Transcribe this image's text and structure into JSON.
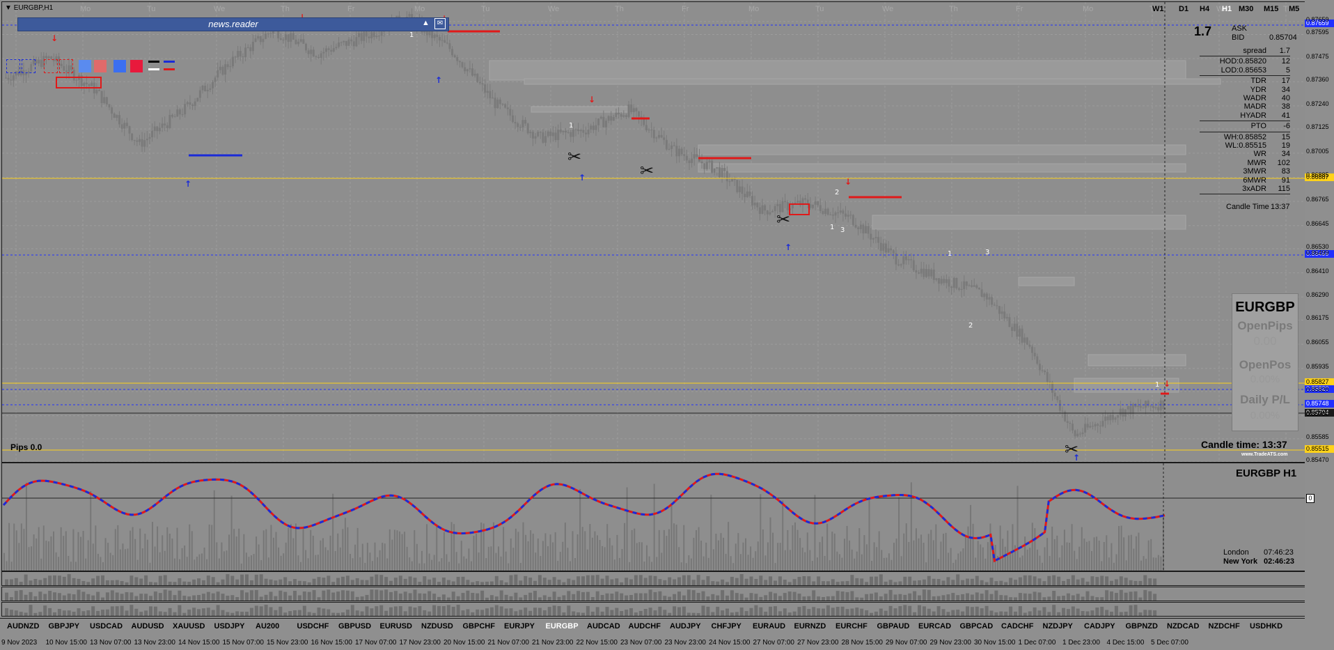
{
  "window": {
    "title": "EURGBP,H1"
  },
  "news_reader": {
    "label": "news.reader"
  },
  "timeframes": [
    "W1",
    "D1",
    "H4",
    "H1",
    "M30",
    "M15",
    "M5"
  ],
  "active_timeframe": "H1",
  "day_labels": [
    "Mo",
    "Tu",
    "We",
    "Th",
    "Fr",
    "Mo",
    "Tu",
    "We",
    "Th",
    "Fr",
    "Mo",
    "Tu",
    "We",
    "Th",
    "Fr",
    "Mo",
    "Tu",
    "We",
    "Th",
    "Fr",
    "Mo"
  ],
  "price_axis": [
    "0.87659",
    "0.87595",
    "0.87475",
    "0.87360",
    "0.87240",
    "0.87125",
    "0.87005",
    "0.86885",
    "0.86765",
    "0.86645",
    "0.86530",
    "0.86499",
    "0.86410",
    "0.86290",
    "0.86175",
    "0.86055",
    "0.85935",
    "0.85820",
    "0.85700",
    "0.85585",
    "0.85470"
  ],
  "price_tags": {
    "top_blue": "0.87659",
    "yellow_high": "0.86887",
    "blue_mid": "0.86499",
    "yellow_low": "0.85827",
    "blue_low1": "0.85820",
    "blue_low2": "0.85748",
    "bid": "0.85704",
    "yellow_bottom": "0.85515"
  },
  "stats": {
    "spread_big": "1.7",
    "ask_label": "ASK",
    "bid_label": "BID",
    "bid_value": "0.85704",
    "rows": [
      {
        "k": "spread",
        "v": "1.7"
      },
      {
        "k": "HOD:0.85820",
        "v": "12"
      },
      {
        "k": "LOD:0.85653",
        "v": "5"
      },
      {
        "k": "TDR",
        "v": "17"
      },
      {
        "k": "YDR",
        "v": "34"
      },
      {
        "k": "WADR",
        "v": "40"
      },
      {
        "k": "MADR",
        "v": "38"
      },
      {
        "k": "HYADR",
        "v": "41"
      },
      {
        "k": "PTO",
        "v": "-6"
      },
      {
        "k": "WH:0.85852",
        "v": "15"
      },
      {
        "k": "WL:0.85515",
        "v": "19"
      },
      {
        "k": "WR",
        "v": "34"
      },
      {
        "k": "MWR",
        "v": "102"
      },
      {
        "k": "3MWR",
        "v": "83"
      },
      {
        "k": "6MWR",
        "v": "91"
      },
      {
        "k": "3xADR",
        "v": "115"
      }
    ],
    "candle_time_label": "Candle Time",
    "candle_time_value": "13:37"
  },
  "panel": {
    "symbol": "EURGBP",
    "open_pips_label": "OpenPips",
    "open_pips_value": "0.00",
    "open_pos_label": "OpenPos",
    "open_pos_value": "0.00%",
    "daily_pl_label": "Daily P/L",
    "daily_pl_value": "0.00%"
  },
  "candle_time_big": {
    "label": "Candle time:",
    "value": "13:37"
  },
  "brand": "www.TradeATS.com",
  "pips_label": "Pips 0.0",
  "osc": {
    "title": "EURGBP  H1",
    "zero_label": "0",
    "london_label": "London",
    "london_time": "07:46:23",
    "newyork_label": "New York",
    "newyork_time": "02:46:23"
  },
  "symbols": [
    "AUDNZD",
    "GBPJPY",
    "USDCAD",
    "AUDUSD",
    "XAUUSD",
    "USDJPY",
    "AU200",
    "USDCHF",
    "GBPUSD",
    "EURUSD",
    "NZDUSD",
    "GBPCHF",
    "EURJPY",
    "EURGBP",
    "AUDCAD",
    "AUDCHF",
    "AUDJPY",
    "CHFJPY",
    "EURAUD",
    "EURNZD",
    "EURCHF",
    "GBPAUD",
    "EURCAD",
    "GBPCAD",
    "CADCHF",
    "NZDJPY",
    "CADJPY",
    "GBPNZD",
    "NZDCAD",
    "NZDCHF",
    "USDHKD"
  ],
  "active_symbol": "EURGBP",
  "time_axis": [
    "9 Nov 2023",
    "10 Nov 15:00",
    "13 Nov 07:00",
    "13 Nov 23:00",
    "14 Nov 15:00",
    "15 Nov 07:00",
    "15 Nov 23:00",
    "16 Nov 15:00",
    "17 Nov 07:00",
    "17 Nov 23:00",
    "20 Nov 15:00",
    "21 Nov 07:00",
    "21 Nov 23:00",
    "22 Nov 15:00",
    "23 Nov 07:00",
    "23 Nov 23:00",
    "24 Nov 15:00",
    "27 Nov 07:00",
    "27 Nov 23:00",
    "28 Nov 15:00",
    "29 Nov 07:00",
    "29 Nov 23:00",
    "30 Nov 15:00",
    "1 Dec 07:00",
    "1 Dec 23:00",
    "4 Dec 15:00",
    "5 Dec 07:00"
  ],
  "chart_data": {
    "type": "line",
    "symbol": "EURGBP",
    "timeframe": "H1",
    "price_range": [
      0.8547,
      0.87659
    ],
    "x": [
      "9 Nov 2023",
      "10 Nov 15:00",
      "13 Nov 07:00",
      "13 Nov 23:00",
      "14 Nov 15:00",
      "15 Nov 07:00",
      "15 Nov 23:00",
      "16 Nov 15:00",
      "17 Nov 07:00",
      "17 Nov 23:00",
      "20 Nov 15:00",
      "21 Nov 07:00",
      "21 Nov 23:00",
      "22 Nov 15:00",
      "23 Nov 07:00",
      "23 Nov 23:00",
      "24 Nov 15:00",
      "27 Nov 07:00",
      "27 Nov 23:00",
      "28 Nov 15:00",
      "29 Nov 07:00",
      "29 Nov 23:00",
      "30 Nov 15:00",
      "1 Dec 07:00",
      "1 Dec 23:00",
      "4 Dec 15:00",
      "5 Dec 07:00"
    ],
    "series": [
      {
        "values": [
          0.8738,
          0.8748,
          0.8732,
          0.8705,
          0.8722,
          0.8745,
          0.8762,
          0.875,
          0.8758,
          0.8768,
          0.8752,
          0.8725,
          0.8708,
          0.8712,
          0.8722,
          0.8702,
          0.8692,
          0.8672,
          0.8676,
          0.8668,
          0.8648,
          0.8638,
          0.863,
          0.8605,
          0.856,
          0.8572,
          0.8576
        ]
      }
    ]
  }
}
